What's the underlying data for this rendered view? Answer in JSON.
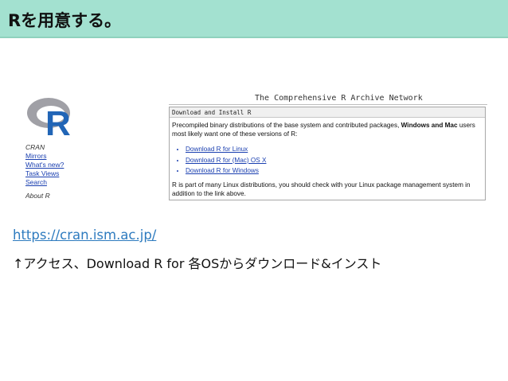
{
  "slide": {
    "title": "Rを用意する。",
    "url": "https://cran.ism.ac.jp/",
    "instruction": "↑アクセス、Download R for 各OSからダウンロード&インスト"
  },
  "cran": {
    "site_title": "The Comprehensive R Archive Network",
    "logo_letter": "R",
    "nav_heading": "CRAN",
    "nav_links": [
      "Mirrors",
      "What's new?",
      "Task Views",
      "Search"
    ],
    "nav_about": "About R",
    "box_heading": "Download and Install R",
    "intro_text_1": "Precompiled binary distributions of the base system and contributed packages,",
    "intro_bold": "Windows and Mac",
    "intro_text_2": "users most likely want one of these versions of R:",
    "download_links": [
      "Download R for Linux",
      "Download R for (Mac) OS X",
      "Download R for Windows"
    ],
    "footer_text": "R is part of many Linux distributions, you should check with your Linux package management system in addition to the link above."
  },
  "colors": {
    "title_bar": "#a3e1d0",
    "link": "#1a3fb0",
    "url_link": "#2e7bbf",
    "logo_blue": "#2165b6",
    "logo_gray": "#a0a0a6"
  }
}
